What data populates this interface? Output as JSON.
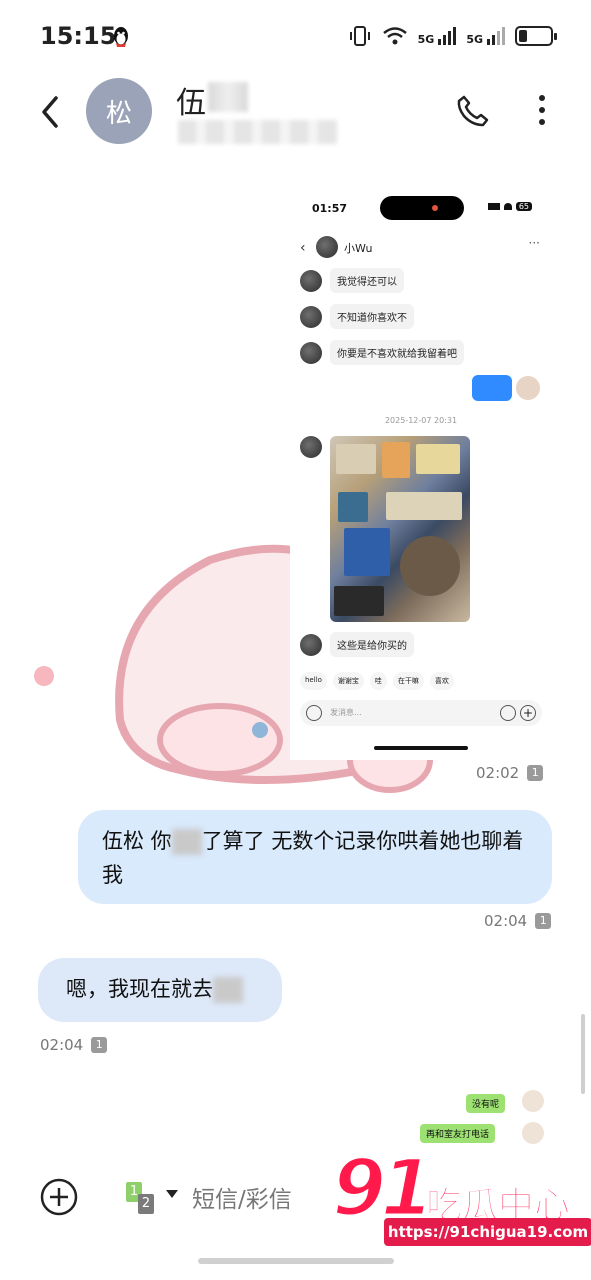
{
  "status_bar": {
    "time": "15:15",
    "network_1": "5G",
    "network_2": "5G",
    "battery_percent": 25
  },
  "header": {
    "avatar_char": "松",
    "contact_name": "伍"
  },
  "embedded_screenshot": {
    "time": "01:57",
    "battery": "65",
    "contact": "小Wu",
    "messages": [
      {
        "text": "我觉得还可以"
      },
      {
        "text": "不知道你喜欢不"
      },
      {
        "text": "你要是不喜欢就给我留着吧"
      }
    ],
    "date_divider": "2025-12-07 20:31",
    "photo_caption": "这些是给你买的",
    "quick_replies": [
      "hello",
      "谢谢宝",
      "哇",
      "在干嘛",
      "喜欢"
    ],
    "input_placeholder": "发消息..."
  },
  "conversation": {
    "time_1": "02:02",
    "sim_1": "1",
    "outgoing_text": "伍松 你",
    "outgoing_text_2": "了算了 无数个记录你哄着她也聊着我",
    "time_2": "02:04",
    "sim_2": "1",
    "incoming_text": "嗯，我现在就去",
    "time_3": "02:04",
    "sim_3": "1"
  },
  "reply_screenshot": {
    "reply_1": "没有呢",
    "reply_2": "再和室友打电话"
  },
  "bottom_bar": {
    "sim_a": "1",
    "sim_b": "2",
    "input_placeholder": "短信/彩信"
  },
  "watermark": {
    "number": "91",
    "brand": "吃瓜中心",
    "url": "https://91chigua19.com"
  }
}
